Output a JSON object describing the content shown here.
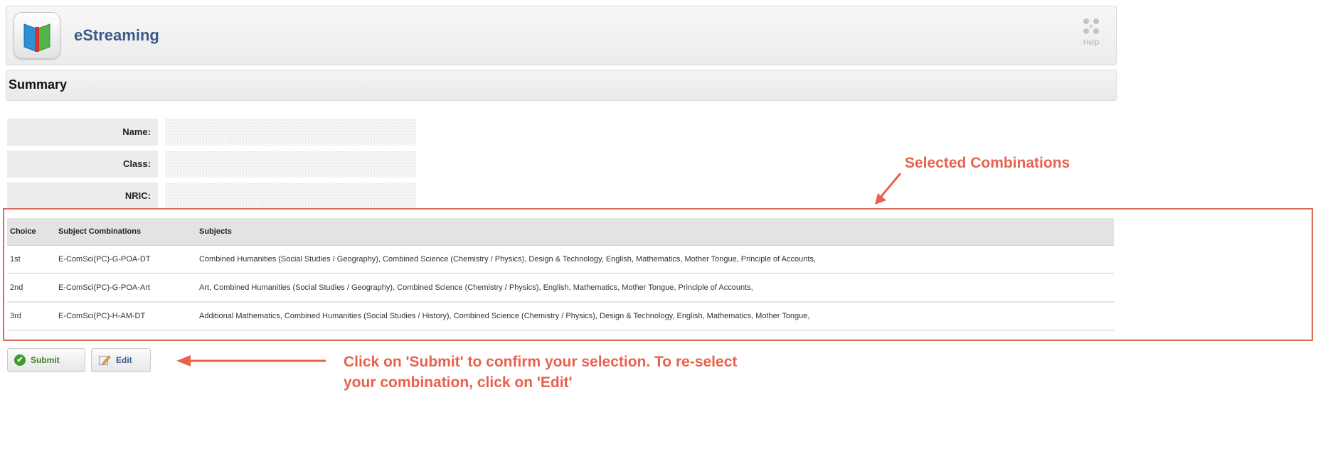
{
  "header": {
    "app_title": "eStreaming",
    "help_label": "Help",
    "icons": {
      "app": "book-icon",
      "help": "help-icon"
    }
  },
  "summary": {
    "title": "Summary"
  },
  "fields": [
    {
      "label": "Name:",
      "value": ""
    },
    {
      "label": "Class:",
      "value": ""
    },
    {
      "label": "NRIC:",
      "value": ""
    }
  ],
  "annotations": {
    "selected_combinations": "Selected Combinations",
    "instruction_line1": "Click on 'Submit' to confirm your selection. To re-select",
    "instruction_line2": "your combination, click on 'Edit'",
    "color": "#e8614c"
  },
  "table": {
    "headers": [
      "Choice",
      "Subject Combinations",
      "Subjects"
    ],
    "rows": [
      [
        "1st",
        "E-ComSci(PC)-G-POA-DT",
        "Combined Humanities (Social Studies / Geography), Combined Science (Chemistry / Physics), Design & Technology, English, Mathematics, Mother Tongue, Principle of Accounts,"
      ],
      [
        "2nd",
        "E-ComSci(PC)-G-POA-Art",
        "Art, Combined Humanities (Social Studies / Geography), Combined Science (Chemistry / Physics), English, Mathematics, Mother Tongue, Principle of Accounts,"
      ],
      [
        "3rd",
        "E-ComSci(PC)-H-AM-DT",
        "Additional Mathematics, Combined Humanities (Social Studies / History), Combined Science (Chemistry / Physics), Design & Technology, English, Mathematics, Mother Tongue,"
      ]
    ]
  },
  "buttons": {
    "submit": {
      "label": "Submit",
      "icon": "check-circle-icon",
      "color": "#3f9a2c"
    },
    "edit": {
      "label": "Edit",
      "icon": "pencil-icon"
    }
  }
}
